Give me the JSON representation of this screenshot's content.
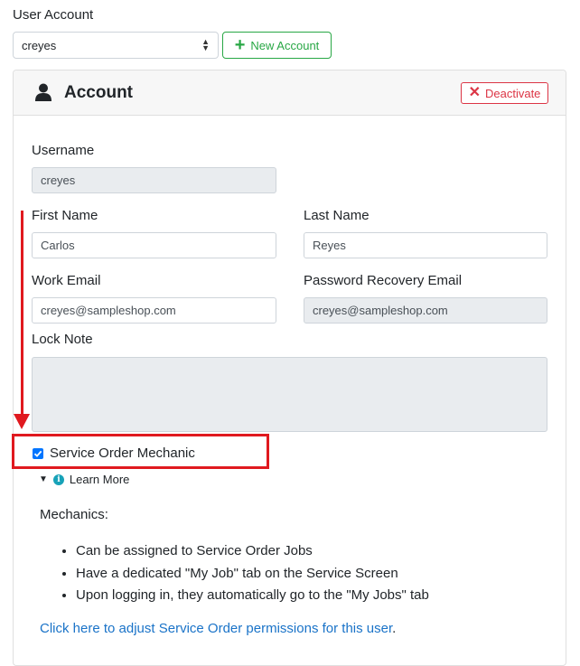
{
  "header": {
    "section_label": "User Account"
  },
  "account_select": {
    "value": "creyes"
  },
  "new_account_button": {
    "label": "New Account"
  },
  "card": {
    "title": "Account",
    "icon": "user-icon",
    "deactivate_label": "Deactivate"
  },
  "form": {
    "username": {
      "label": "Username",
      "value": "creyes"
    },
    "first_name": {
      "label": "First Name",
      "value": "Carlos"
    },
    "last_name": {
      "label": "Last Name",
      "value": "Reyes"
    },
    "work_email": {
      "label": "Work Email",
      "value": "creyes@sampleshop.com"
    },
    "recovery_email": {
      "label": "Password Recovery Email",
      "value": "creyes@sampleshop.com"
    },
    "lock_note": {
      "label": "Lock Note",
      "value": ""
    }
  },
  "mechanic": {
    "checkbox_label": "Service Order Mechanic",
    "checked": true,
    "learn_more": "Learn More",
    "heading": "Mechanics:",
    "bullets": [
      "Can be assigned to Service Order Jobs",
      "Have a dedicated \"My Job\" tab on the Service Screen",
      "Upon logging in, they automatically go to the \"My Jobs\" tab"
    ],
    "link_text": "Click here to adjust Service Order permissions for this user",
    "link_suffix": "."
  },
  "colors": {
    "success": "#28a745",
    "danger": "#dc3545",
    "annotation": "#e0191f",
    "link": "#1a73c8",
    "checkbox": "#0075ff",
    "info": "#17a2b8"
  }
}
